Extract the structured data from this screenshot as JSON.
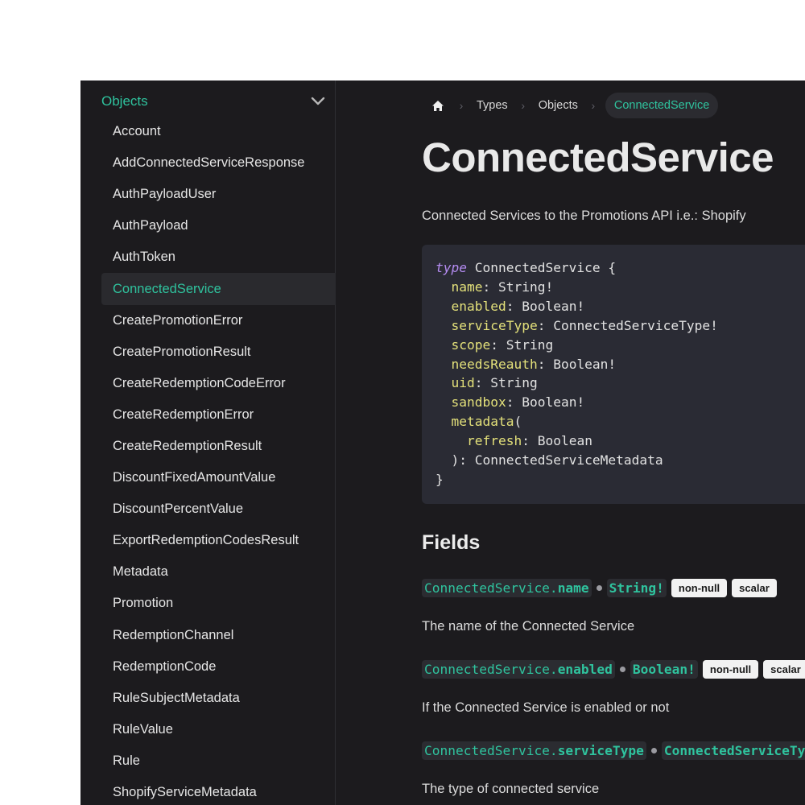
{
  "sidebar": {
    "section_title": "Objects",
    "items": [
      "Account",
      "AddConnectedServiceResponse",
      "AuthPayloadUser",
      "AuthPayload",
      "AuthToken",
      "ConnectedService",
      "CreatePromotionError",
      "CreatePromotionResult",
      "CreateRedemptionCodeError",
      "CreateRedemptionError",
      "CreateRedemptionResult",
      "DiscountFixedAmountValue",
      "DiscountPercentValue",
      "ExportRedemptionCodesResult",
      "Metadata",
      "Promotion",
      "RedemptionChannel",
      "RedemptionCode",
      "RuleSubjectMetadata",
      "RuleValue",
      "Rule",
      "ShopifyServiceMetadata"
    ],
    "active_item": "ConnectedService"
  },
  "breadcrumb": {
    "home_icon": "home-icon",
    "items": [
      "Types",
      "Objects"
    ],
    "current": "ConnectedService"
  },
  "page": {
    "title": "ConnectedService",
    "description": "Connected Services to the Promotions API i.e.: Shopify"
  },
  "code": {
    "keyword": "type",
    "type_name": "ConnectedService",
    "fields": [
      {
        "name": "name",
        "type": "String!"
      },
      {
        "name": "enabled",
        "type": "Boolean!"
      },
      {
        "name": "serviceType",
        "type": "ConnectedServiceType!"
      },
      {
        "name": "scope",
        "type": "String"
      },
      {
        "name": "needsReauth",
        "type": "Boolean!"
      },
      {
        "name": "uid",
        "type": "String"
      },
      {
        "name": "sandbox",
        "type": "Boolean!"
      }
    ],
    "method": {
      "name": "metadata",
      "arg_name": "refresh",
      "arg_type": "Boolean",
      "return_type": "ConnectedServiceMetadata"
    }
  },
  "fields_section": {
    "heading": "Fields",
    "fields": [
      {
        "prefix": "ConnectedService.",
        "name": "name",
        "type": "String!",
        "badges": [
          "non-null",
          "scalar"
        ],
        "description": "The name of the Connected Service"
      },
      {
        "prefix": "ConnectedService.",
        "name": "enabled",
        "type": "Boolean!",
        "badges": [
          "non-null",
          "scalar"
        ],
        "description": "If the Connected Service is enabled or not"
      },
      {
        "prefix": "ConnectedService.",
        "name": "serviceType",
        "type": "ConnectedServiceTy",
        "badges": [],
        "description": "The type of connected service"
      }
    ]
  },
  "colors": {
    "accent": "#2fc39e",
    "background": "#1c1b1e",
    "code_background": "#2a2b34",
    "keyword": "#b58cf2",
    "field_name": "#e3e07a"
  }
}
